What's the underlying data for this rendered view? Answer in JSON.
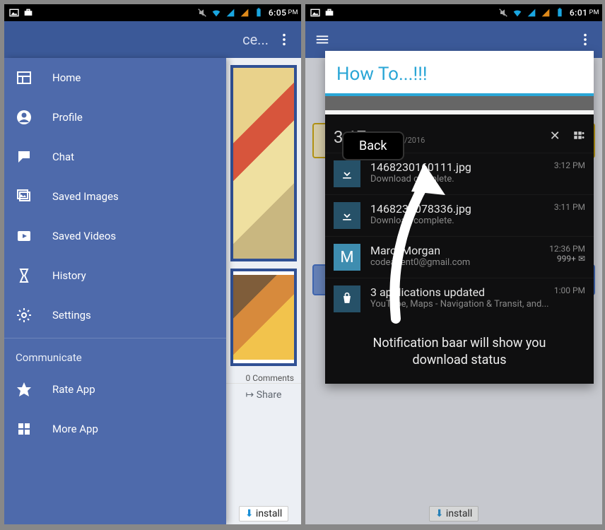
{
  "status": {
    "left_time": "6:05",
    "right_time": "6:01",
    "ampm": "PM"
  },
  "appbar": {
    "title_trunc": "ce..."
  },
  "drawer": {
    "items": [
      {
        "label": "Home"
      },
      {
        "label": "Profile"
      },
      {
        "label": "Chat"
      },
      {
        "label": "Saved Images"
      },
      {
        "label": "Saved Videos"
      },
      {
        "label": "History"
      },
      {
        "label": "Settings"
      }
    ],
    "communicate_header": "Communicate",
    "comm_items": [
      {
        "label": "Rate App"
      },
      {
        "label": "More App"
      }
    ]
  },
  "feed": {
    "comments_label": "0 Comments",
    "share_label": "Share",
    "install_label": "install"
  },
  "dialog": {
    "title": "How To...!!!",
    "back": "Back",
    "time_big": "3:17",
    "date_small": "11/07/2016",
    "pm": "PM",
    "close_glyph": "✕",
    "notifs": [
      {
        "title": "1468230160111.jpg",
        "sub": "Download complete.",
        "time": "3:12 PM",
        "icon": "download"
      },
      {
        "title": "1468230078336.jpg",
        "sub": "Download complete.",
        "time": "3:11 PM",
        "icon": "download"
      },
      {
        "title": "Marci Morgan",
        "sub": "codeagent0@gmail.com",
        "time": "12:36 PM",
        "count": "999+",
        "icon": "M"
      },
      {
        "title": "3 applications updated",
        "sub": "YouTube, Maps - Navigation & Transit, and...",
        "time": "1:00 PM",
        "icon": "bag"
      }
    ],
    "caption_l1": "Notification baar will show you",
    "caption_l2": "download status"
  }
}
